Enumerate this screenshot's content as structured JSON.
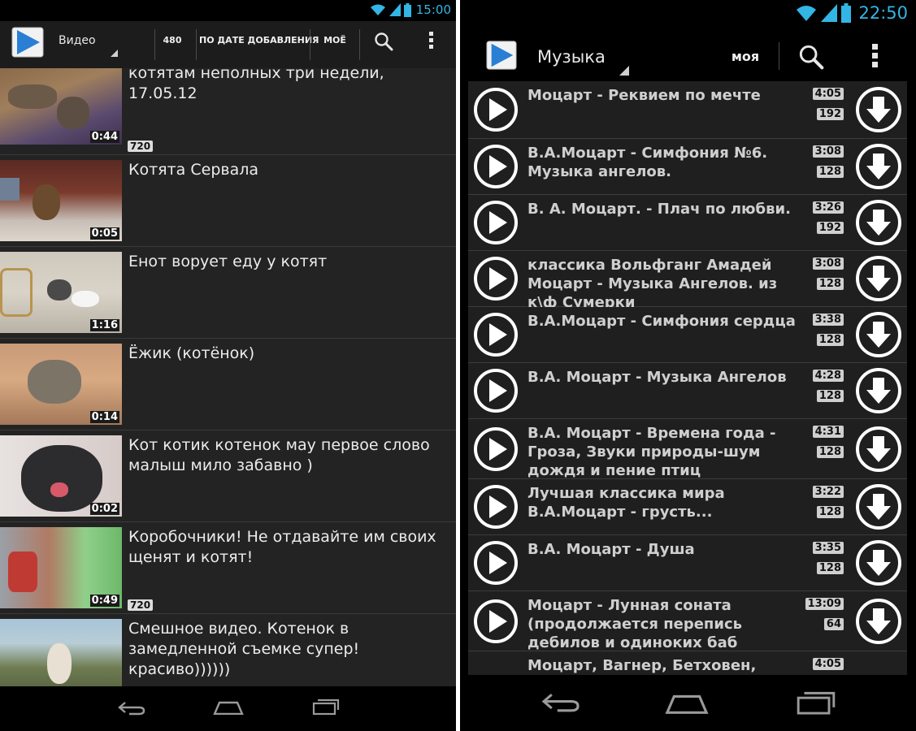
{
  "left": {
    "status": {
      "time": "15:00"
    },
    "actionbar": {
      "title": "Видео",
      "quality_label": "480",
      "sort_label": "ПО ДАТЕ ДОБАВЛЕНИЯ",
      "mine_label": "МОЁ"
    },
    "videos": [
      {
        "title": "котятам неполных три недели, 17.05.12",
        "duration": "0:44",
        "quality": "720"
      },
      {
        "title": "Котята Сервала",
        "duration": "0:05",
        "quality": ""
      },
      {
        "title": "Енот ворует еду у котят",
        "duration": "1:16",
        "quality": ""
      },
      {
        "title": "Ёжик (котёнок)",
        "duration": "0:14",
        "quality": ""
      },
      {
        "title": "Кот котик котенок мау первое слово малыш мило забавно )",
        "duration": "0:02",
        "quality": ""
      },
      {
        "title": "Коробочники! Не отдавайте им своих щенят и котят!",
        "duration": "0:49",
        "quality": "720"
      },
      {
        "title": "Смешное видео. Котенок в замедленной съемке супер!красиво))))))",
        "duration": "",
        "quality": ""
      }
    ]
  },
  "right": {
    "status": {
      "time": "22:50"
    },
    "actionbar": {
      "title": "Музыка",
      "mine_label": "моя"
    },
    "tracks": [
      {
        "title": "Моцарт - Реквием по мечте",
        "duration": "4:05",
        "bitrate": "192"
      },
      {
        "title": "В.А.Моцарт - Симфония №6. Музыка ангелов.",
        "duration": "3:08",
        "bitrate": "128"
      },
      {
        "title": "В. А. Моцарт. - Плач по любви.",
        "duration": "3:26",
        "bitrate": "192"
      },
      {
        "title": "классика Вольфганг Амадей Моцарт - Музыка Ангелов. из к\\ф Сумерки",
        "duration": "3:08",
        "bitrate": "128"
      },
      {
        "title": "В.А.Моцарт - Симфония сердца",
        "duration": "3:38",
        "bitrate": "128"
      },
      {
        "title": "В.А. Моцарт - Музыка Ангелов",
        "duration": "4:28",
        "bitrate": "128"
      },
      {
        "title": "В.А. Моцарт -  Времена года - Гроза, Звуки природы-шум дождя и пение птиц",
        "duration": "4:31",
        "bitrate": "128"
      },
      {
        "title": "Лучшая классика мира В.А.Моцарт - грусть...",
        "duration": "3:22",
        "bitrate": "128"
      },
      {
        "title": "В.А. Моцарт - Душа",
        "duration": "3:35",
        "bitrate": "128"
      },
      {
        "title": "Моцарт - Лунная соната (продолжается перепись дебилов и одиноких баб ВКонтакта)",
        "duration": "13:09",
        "bitrate": "64"
      },
      {
        "title": "Моцарт, Вагнер, Бетховен,",
        "duration": "4:05",
        "bitrate": ""
      }
    ]
  },
  "icons": {
    "wifi": "wifi-icon",
    "signal": "signal-icon",
    "battery": "battery-icon",
    "search": "search-icon",
    "overflow": "overflow-menu-icon",
    "play": "play-icon",
    "download": "download-icon",
    "back": "back-icon",
    "home": "home-icon",
    "recents": "recents-icon"
  },
  "colors": {
    "accent": "#33b5e5",
    "logo_blue": "#2a7fd4",
    "background": "#000000",
    "actionbar": "#1c1c1c"
  }
}
